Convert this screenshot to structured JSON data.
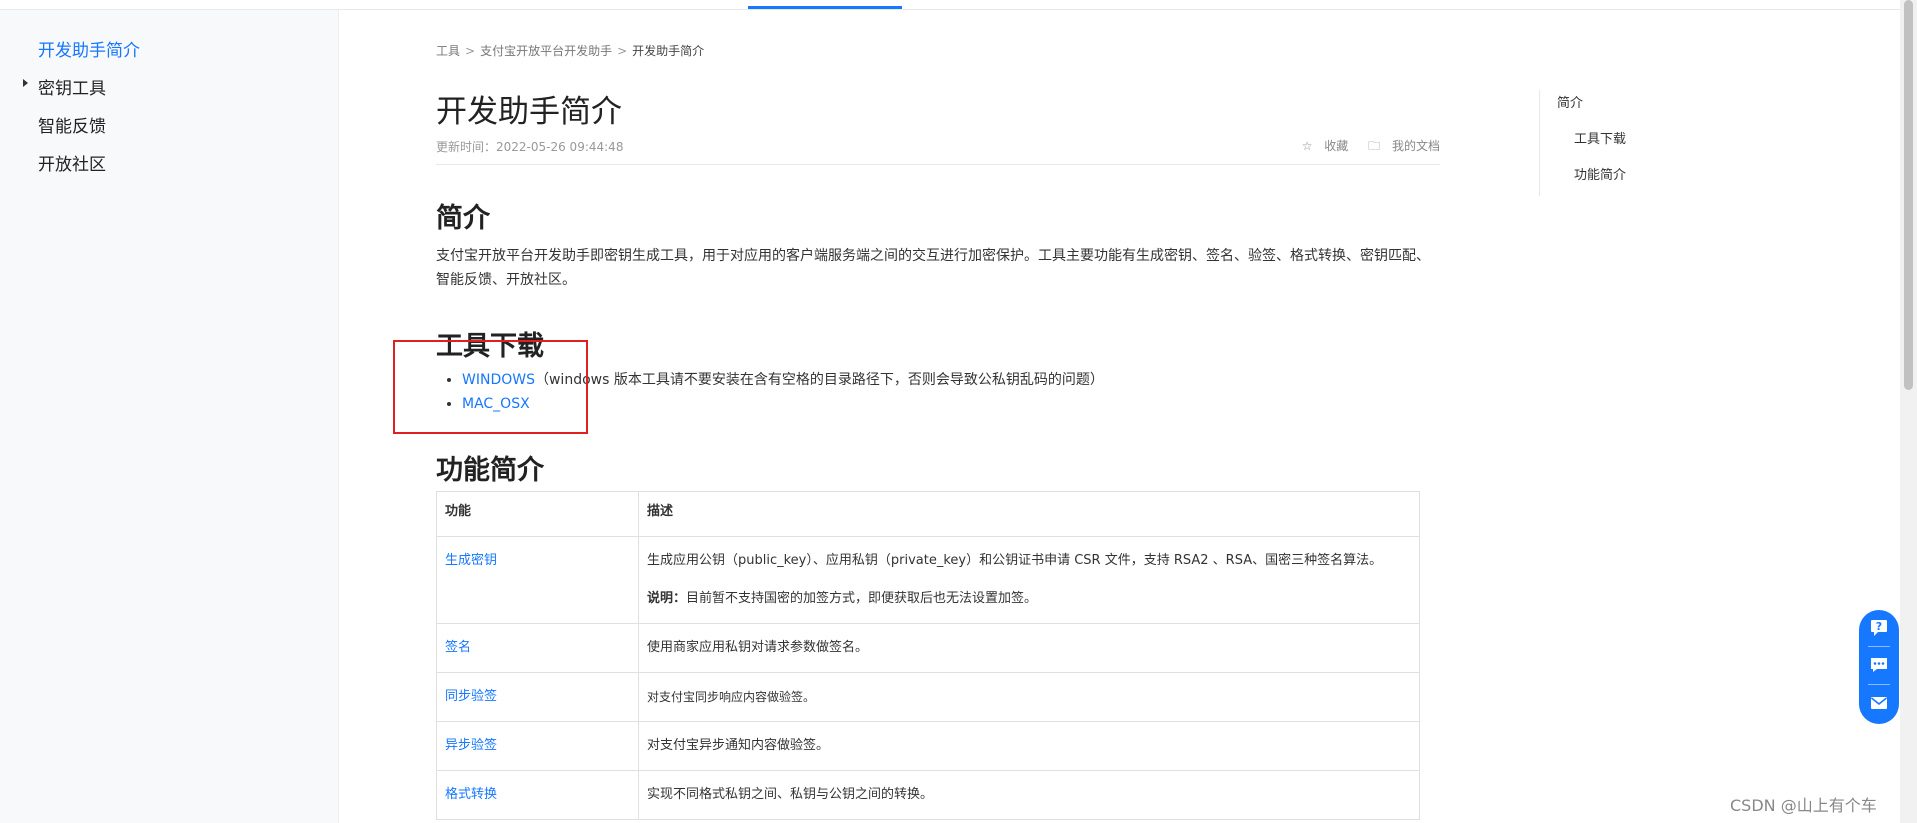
{
  "sidebar": {
    "items": [
      {
        "label": "开发助手简介",
        "active": true
      },
      {
        "label": "密钥工具",
        "expandable": true
      },
      {
        "label": "智能反馈"
      },
      {
        "label": "开放社区"
      }
    ]
  },
  "breadcrumb": [
    "工具",
    "支付宝开放平台开发助手",
    "开发助手简介"
  ],
  "page": {
    "title": "开发助手简介",
    "update_time": "更新时间：2022-05-26 09:44:48",
    "actions": {
      "collect": "收藏",
      "my_docs": "我的文档",
      "collect_icon": "star-icon",
      "docs_icon": "folder-icon"
    }
  },
  "sections": {
    "intro": {
      "heading": "简介",
      "text": "支付宝开放平台开发助手即密钥生成工具，用于对应用的客户端服务端之间的交互进行加密保护。工具主要功能有生成密钥、签名、验签、格式转换、密钥匹配、智能反馈、开放社区。"
    },
    "download": {
      "heading": "工具下载",
      "items": [
        {
          "link": "WINDOWS",
          "note": "（windows 版本工具请不要安装在含有空格的目录路径下，否则会导致公私钥乱码的问题）"
        },
        {
          "link": "MAC_OSX",
          "note": ""
        }
      ]
    },
    "features": {
      "heading": "功能简介",
      "columns": [
        "功能",
        "描述"
      ],
      "rows": [
        {
          "name": "生成密钥",
          "desc": "生成应用公钥（public_key）、应用私钥（private_key）和公钥证书申请 CSR 文件，支持 RSA2 、RSA、国密三种签名算法。",
          "note_label": "说明：",
          "note": "目前暂不支持国密的加签方式，即便获取后也无法设置加签。"
        },
        {
          "name": "签名",
          "desc": "使用商家应用私钥对请求参数做签名。"
        },
        {
          "name": "同步验签",
          "desc": "对支付宝同步响应内容做验签。"
        },
        {
          "name": "异步验签",
          "desc": "对支付宝异步通知内容做验签。"
        },
        {
          "name": "格式转换",
          "desc": "实现不同格式私钥之间、私钥与公钥之间的转换。"
        }
      ]
    }
  },
  "toc": {
    "items": [
      "简介",
      "工具下载",
      "功能简介"
    ]
  },
  "float_buttons": [
    "help-icon",
    "chat-icon",
    "feedback-mail-icon"
  ],
  "watermark": "CSDN @山上有个车",
  "colors": {
    "accent": "#1677ff",
    "annotation_box": "#e02020"
  }
}
